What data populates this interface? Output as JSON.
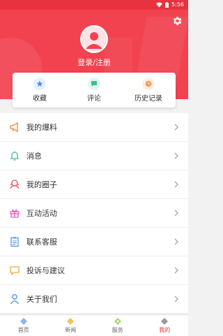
{
  "status": {
    "time": "5:56"
  },
  "header": {
    "login_label": "登录/注册"
  },
  "card": {
    "items": [
      {
        "label": "收藏"
      },
      {
        "label": "评论"
      },
      {
        "label": "历史记录"
      }
    ]
  },
  "menu": {
    "items": [
      {
        "label": "我的爆料"
      },
      {
        "label": "消息"
      },
      {
        "label": "我的圈子"
      },
      {
        "label": "互动活动"
      },
      {
        "label": "联系客服"
      },
      {
        "label": "投诉与建议"
      },
      {
        "label": "关于我们"
      }
    ]
  },
  "tabs": [
    {
      "label": "首页"
    },
    {
      "label": "新闻"
    },
    {
      "label": "服务"
    },
    {
      "label": "我的"
    }
  ],
  "colors": {
    "brand": "#f24250",
    "accent": "#e8323f"
  }
}
